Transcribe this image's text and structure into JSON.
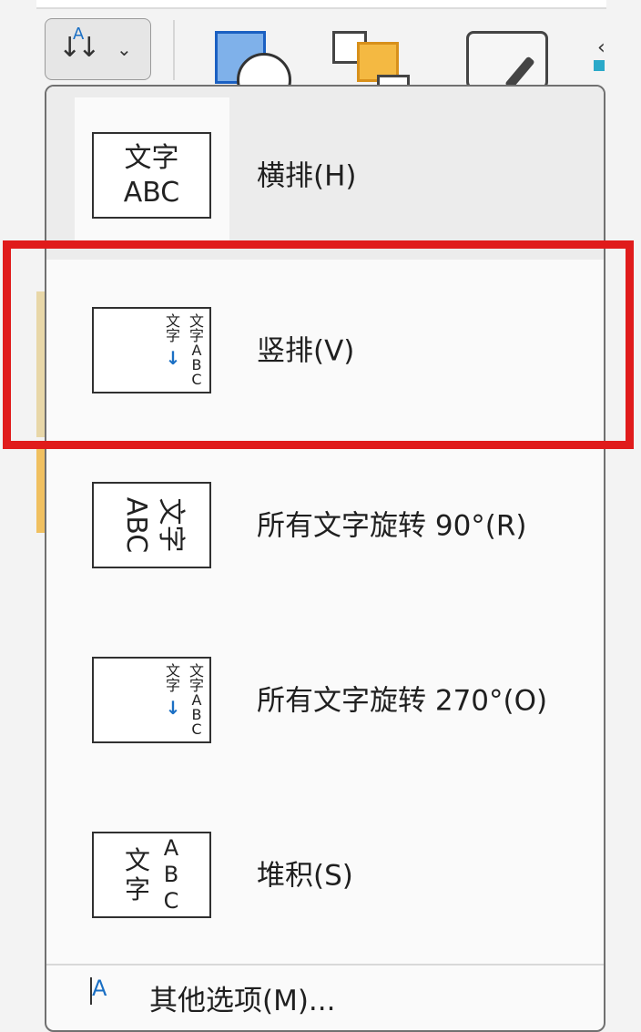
{
  "ribbon": {
    "text_direction_button": {
      "icon": "text-direction-icon",
      "arrows": "↓↓",
      "letter": "A",
      "chevron": "⌄"
    },
    "more_glyph": "‹"
  },
  "menu": {
    "items": [
      {
        "id": "horizontal",
        "label": "横排(H)",
        "preview": "horizontal",
        "line1": "文字",
        "line2": "ABC",
        "selected": true
      },
      {
        "id": "vertical",
        "label": "竖排(V)",
        "preview": "vertical",
        "col1": "文字ABC",
        "col2": "文字",
        "arrow": "↓"
      },
      {
        "id": "rotate90",
        "label": "所有文字旋转 90°(R)",
        "preview": "rotate90",
        "line1": "文字",
        "line2": "ABC"
      },
      {
        "id": "rotate270",
        "label": "所有文字旋转 270°(O)",
        "preview": "rotate270",
        "col1": "文字ABC",
        "col2": "文字",
        "arrow": "↓"
      },
      {
        "id": "stacked",
        "label": "堆积(S)",
        "preview": "stacked",
        "chars": "文字",
        "letters": "ABC"
      }
    ],
    "more_options": {
      "label": "其他选项(M)...",
      "icon": "A"
    }
  },
  "colors": {
    "accent_blue": "#1a6fc4",
    "highlight_red": "#e01b1b"
  }
}
